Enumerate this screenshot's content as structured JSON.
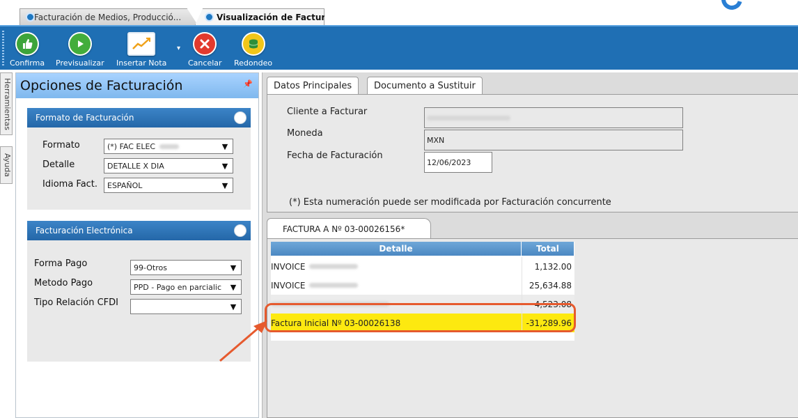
{
  "tabs": [
    {
      "label": "Facturación de Medios, Producció..."
    },
    {
      "label": "Visualización de Factura"
    }
  ],
  "toolbar": {
    "confirma": "Confirma",
    "previsualizar": "Previsualizar",
    "insertar_nota": "Insertar Nota",
    "cancelar": "Cancelar",
    "redondeo": "Redondeo"
  },
  "side_tabs": {
    "herramientas": "Herramientas",
    "ayuda": "Ayuda"
  },
  "left_panel": {
    "title": "Opciones de Facturación",
    "formato_group": {
      "title": "Formato de Facturación",
      "formato_label": "Formato",
      "formato_value": "(*) FAC ELEC",
      "detalle_label": "Detalle",
      "detalle_value": "DETALLE X DIA",
      "idioma_label": "Idioma Fact.",
      "idioma_value": "ESPAÑOL"
    },
    "fe_group": {
      "title": "Facturación Electrónica",
      "forma_pago_label": "Forma Pago",
      "forma_pago_value": "99-Otros",
      "metodo_pago_label": "Metodo Pago",
      "metodo_pago_value": "PPD - Pago en parcialic",
      "tipo_relacion_label": "Tipo Relación CFDI",
      "tipo_relacion_value": ""
    }
  },
  "panel_tabs": {
    "datos": "Datos Principales",
    "documento": "Documento a Sustituir"
  },
  "datos": {
    "cliente_label": "Cliente a Facturar",
    "moneda_label": "Moneda",
    "moneda_value": "MXN",
    "fecha_label": "Fecha de Facturación",
    "fecha_value": "12/06/2023",
    "note": "(*) Esta numeración puede ser modificada por Facturación concurrente"
  },
  "factura": {
    "tab_label": "FACTURA A Nº 03-00026156*",
    "columns": {
      "detalle": "Detalle",
      "total": "Total"
    },
    "rows": [
      {
        "detalle": "INVOICE",
        "total": "1,132.00"
      },
      {
        "detalle": "INVOICE",
        "total": "25,634.88"
      },
      {
        "detalle": "",
        "total": "4,523.08"
      },
      {
        "detalle": "Factura Inicial Nº 03-00026138",
        "total": "-31,289.96"
      }
    ]
  },
  "colors": {
    "toolbar": "#1f6fb4",
    "highlight": "#fde910",
    "annotation": "#e65a2e"
  }
}
